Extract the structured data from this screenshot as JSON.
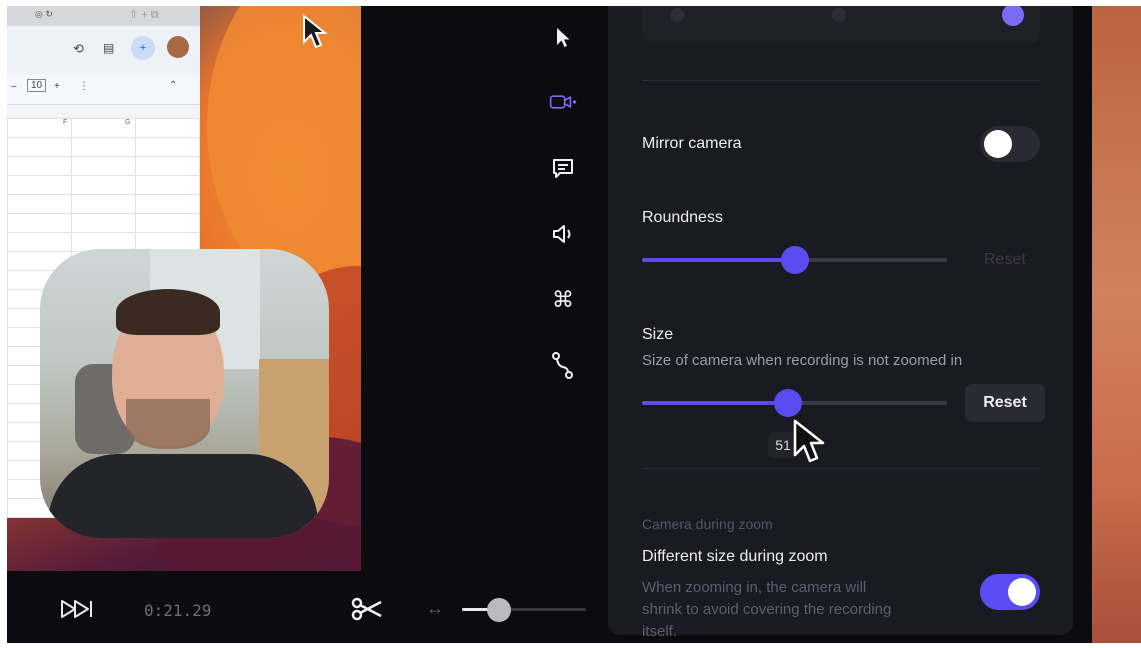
{
  "browser": {
    "zoom_value": "10",
    "columns": [
      "F",
      "G"
    ]
  },
  "playback": {
    "timecode": "0:21.29",
    "timeline_zoom_percent": 30
  },
  "rail": {
    "icons": [
      "pointer-icon",
      "camera-icon",
      "captions-icon",
      "audio-icon",
      "shortcut-icon",
      "path-icon"
    ],
    "accent": "#7b6cf5"
  },
  "settings": {
    "mirror_camera": {
      "label": "Mirror camera",
      "enabled": false
    },
    "roundness": {
      "label": "Roundness",
      "value_percent": 50,
      "reset_label": "Reset"
    },
    "size": {
      "label": "Size",
      "description": "Size of camera when recording is not zoomed in",
      "value_percent": 48,
      "reset_label": "Reset",
      "tooltip_value": "51"
    },
    "zoom_section": {
      "heading": "Camera during zoom",
      "different_size": {
        "label": "Different size during zoom",
        "description_lines": [
          "When zooming in, the camera will",
          "shrink to avoid covering the recording",
          "itself."
        ],
        "enabled": true
      }
    }
  },
  "colors": {
    "accent": "#5b4cf2",
    "panel_bg": "#1a1a22",
    "app_bg": "#0c0b10"
  }
}
